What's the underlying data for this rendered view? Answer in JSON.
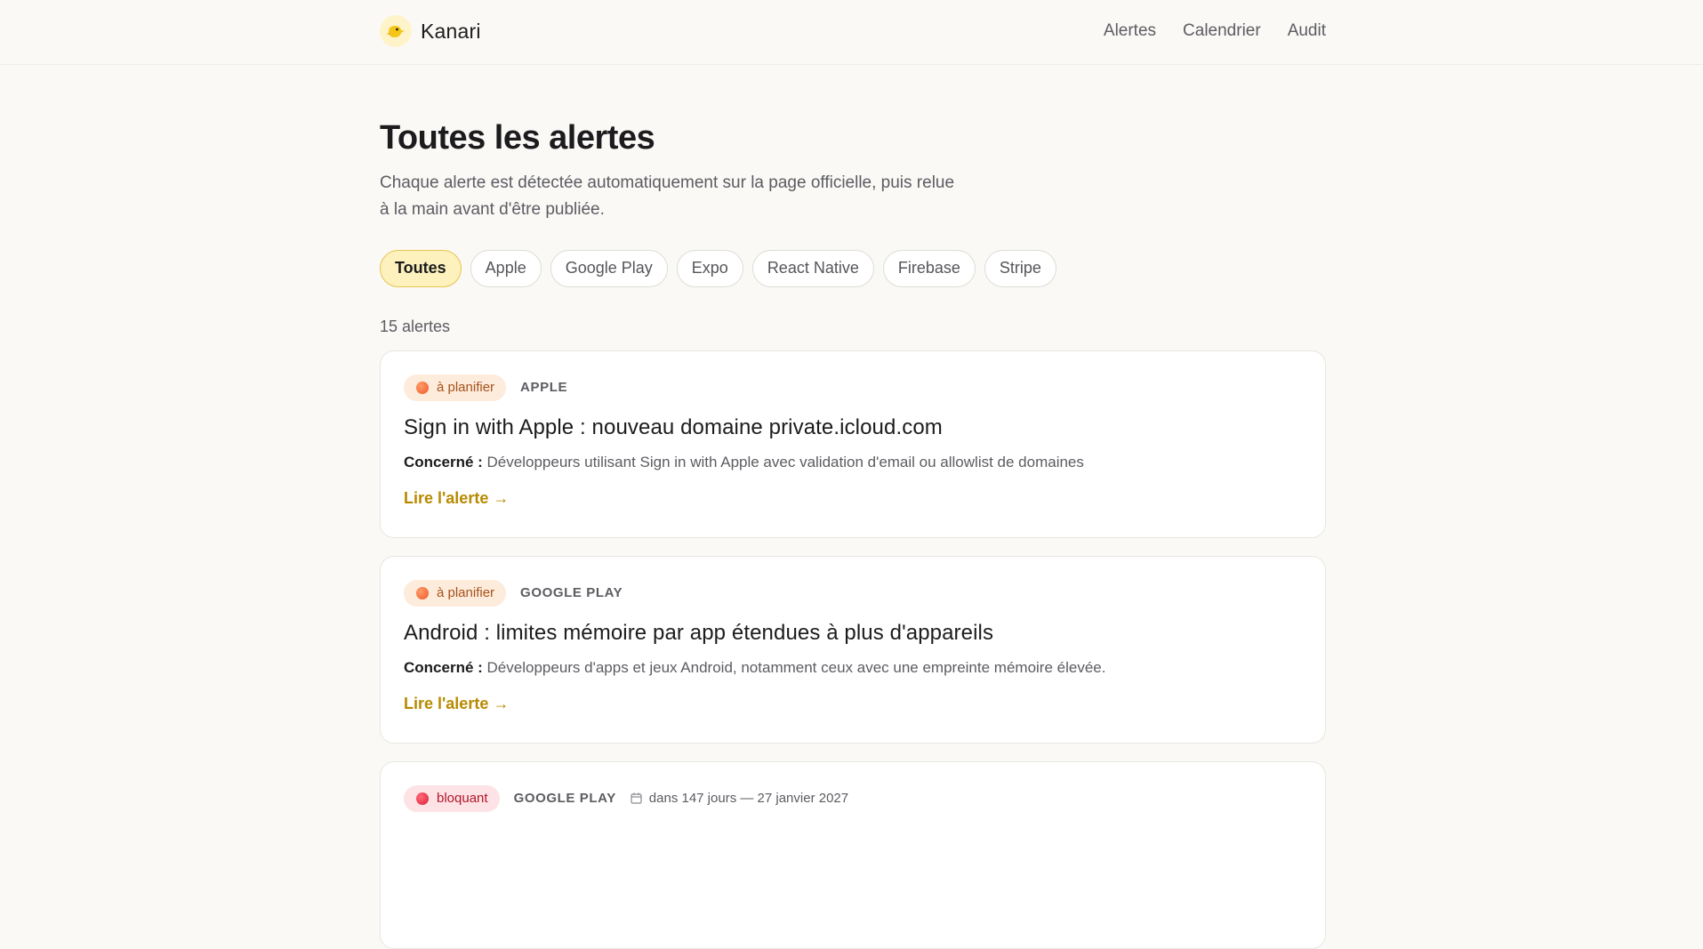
{
  "header": {
    "brand": "Kanari",
    "nav": [
      "Alertes",
      "Calendrier",
      "Audit"
    ]
  },
  "page": {
    "title": "Toutes les alertes",
    "subtitle": "Chaque alerte est détectée automatiquement sur la page officielle, puis relue à la main avant d'être publiée."
  },
  "filters": {
    "active": "Toutes",
    "items": [
      "Toutes",
      "Apple",
      "Google Play",
      "Expo",
      "React Native",
      "Firebase",
      "Stripe"
    ]
  },
  "count_label": "15 alertes",
  "cards": [
    {
      "status": "à planifier",
      "platform": "APPLE",
      "due": "",
      "title": "Sign in with Apple : nouveau domaine private.icloud.com",
      "concern_label": "Concerné :",
      "concern": "Développeurs utilisant Sign in with Apple avec validation d'email ou allowlist de domaines",
      "link": "Lire l'alerte →"
    },
    {
      "status": "à planifier",
      "platform": "GOOGLE PLAY",
      "due": "",
      "title": "Android : limites mémoire par app étendues à plus d'appareils",
      "concern_label": "Concerné :",
      "concern": "Développeurs d'apps et jeux Android, notamment ceux avec une empreinte mémoire élevée.",
      "link": "Lire l'alerte →"
    },
    {
      "status": "bloquant",
      "platform": "GOOGLE PLAY",
      "due": "dans 147 jours — 27 janvier 2027",
      "title": "",
      "concern_label": "",
      "concern": "",
      "link": ""
    }
  ],
  "colors": {
    "accent": "#b88a00",
    "chip_active_bg": "#fdf1bd",
    "status_plan": "#ee5a2a",
    "status_block": "#dc1e37"
  }
}
